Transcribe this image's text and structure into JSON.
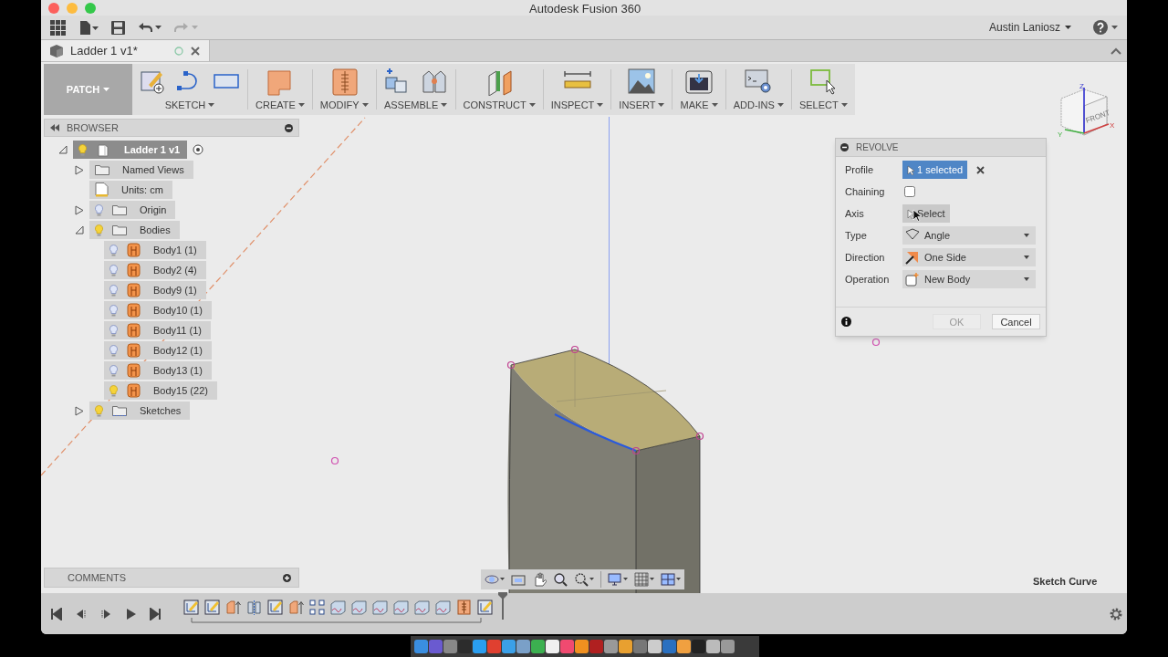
{
  "window": {
    "title": "Autodesk Fusion 360"
  },
  "account": {
    "user": "Austin Laniosz"
  },
  "document_tab": {
    "title": "Ladder 1 v1*"
  },
  "workspace": {
    "label": "PATCH"
  },
  "toolbar": [
    {
      "label": "SKETCH"
    },
    {
      "label": "CREATE"
    },
    {
      "label": "MODIFY"
    },
    {
      "label": "ASSEMBLE"
    },
    {
      "label": "CONSTRUCT"
    },
    {
      "label": "INSPECT"
    },
    {
      "label": "INSERT"
    },
    {
      "label": "MAKE"
    },
    {
      "label": "ADD-INS"
    },
    {
      "label": "SELECT"
    }
  ],
  "browser": {
    "title": "BROWSER",
    "tree": [
      {
        "kind": "component",
        "label": "Ladder 1 v1",
        "selected": true,
        "expanded": true,
        "visible": true,
        "children": [
          {
            "kind": "folder",
            "label": "Named Views",
            "selected": false,
            "expanded": false
          },
          {
            "kind": "document",
            "label": "Units: cm",
            "selected": false
          },
          {
            "kind": "folder",
            "label": "Origin",
            "selected": false,
            "expanded": false,
            "visible": false
          },
          {
            "kind": "folder",
            "label": "Bodies",
            "selected": false,
            "expanded": true,
            "visible": true,
            "children": [
              {
                "kind": "body",
                "label": "Body1 (1)",
                "selected": false,
                "visible": false
              },
              {
                "kind": "body",
                "label": "Body2 (4)",
                "selected": false,
                "visible": false
              },
              {
                "kind": "body",
                "label": "Body9 (1)",
                "selected": false,
                "visible": false
              },
              {
                "kind": "body",
                "label": "Body10 (1)",
                "selected": false,
                "visible": false
              },
              {
                "kind": "body",
                "label": "Body11 (1)",
                "selected": false,
                "visible": false
              },
              {
                "kind": "body",
                "label": "Body12 (1)",
                "selected": false,
                "visible": false
              },
              {
                "kind": "body",
                "label": "Body13 (1)",
                "selected": false,
                "visible": false
              },
              {
                "kind": "body",
                "label": "Body15 (22)",
                "selected": false,
                "visible": true
              }
            ]
          },
          {
            "kind": "sketches",
            "label": "Sketches",
            "selected": false,
            "expanded": false,
            "visible": true
          }
        ]
      }
    ]
  },
  "view_cube": {
    "face": "FRONT",
    "axes": [
      "Z",
      "Y",
      "X"
    ]
  },
  "dialog": {
    "title": "REVOLVE",
    "rows": [
      {
        "kind": "selection",
        "label": "Profile",
        "value": "1 selected",
        "selected": true
      },
      {
        "kind": "checkbox",
        "label": "Chaining",
        "checked": false
      },
      {
        "kind": "selection",
        "label": "Axis",
        "value": "Select",
        "selected": false
      },
      {
        "kind": "dropdown",
        "label": "Type",
        "value": "Angle"
      },
      {
        "kind": "dropdown",
        "label": "Direction",
        "value": "One Side"
      },
      {
        "kind": "dropdown",
        "label": "Operation",
        "value": "New Body"
      }
    ],
    "buttons": [
      {
        "label": "OK",
        "disabled": true
      },
      {
        "label": "Cancel",
        "disabled": false
      }
    ]
  },
  "comments": {
    "title": "COMMENTS"
  },
  "status": "Sketch Curve",
  "timeline": {
    "items": [
      {
        "kind": "sketch"
      },
      {
        "kind": "sketch"
      },
      {
        "kind": "extrude"
      },
      {
        "kind": "mirror"
      },
      {
        "kind": "sketch"
      },
      {
        "kind": "extrude"
      },
      {
        "kind": "pattern"
      },
      {
        "kind": "patch"
      },
      {
        "kind": "patch"
      },
      {
        "kind": "patch"
      },
      {
        "kind": "patch"
      },
      {
        "kind": "patch"
      },
      {
        "kind": "patch"
      },
      {
        "kind": "split"
      },
      {
        "kind": "sketch"
      }
    ]
  }
}
